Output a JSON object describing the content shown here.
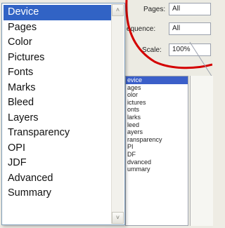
{
  "dialog": {
    "pages_label": "Pages:",
    "pages_value": "All",
    "sequence_label": "equence:",
    "sequence_value": "All",
    "scale_label": "Scale:",
    "scale_value": "100%"
  },
  "background_list": {
    "items": [
      "evice",
      "ages",
      "olor",
      "ictures",
      "onts",
      "larks",
      "leed",
      "ayers",
      "ransparency",
      "PI",
      "DF",
      "dvanced",
      "ummary"
    ],
    "selected_index": 0
  },
  "dropdown": {
    "items": [
      "Device",
      "Pages",
      "Color",
      "Pictures",
      "Fonts",
      "Marks",
      "Bleed",
      "Layers",
      "Transparency",
      "OPI",
      "JDF",
      "Advanced",
      "Summary"
    ],
    "selected_index": 0,
    "scroll_up_glyph": "˄",
    "scroll_down_glyph": "˅"
  },
  "colors": {
    "selection": "#3163c5",
    "annotation_red": "#d40000"
  }
}
